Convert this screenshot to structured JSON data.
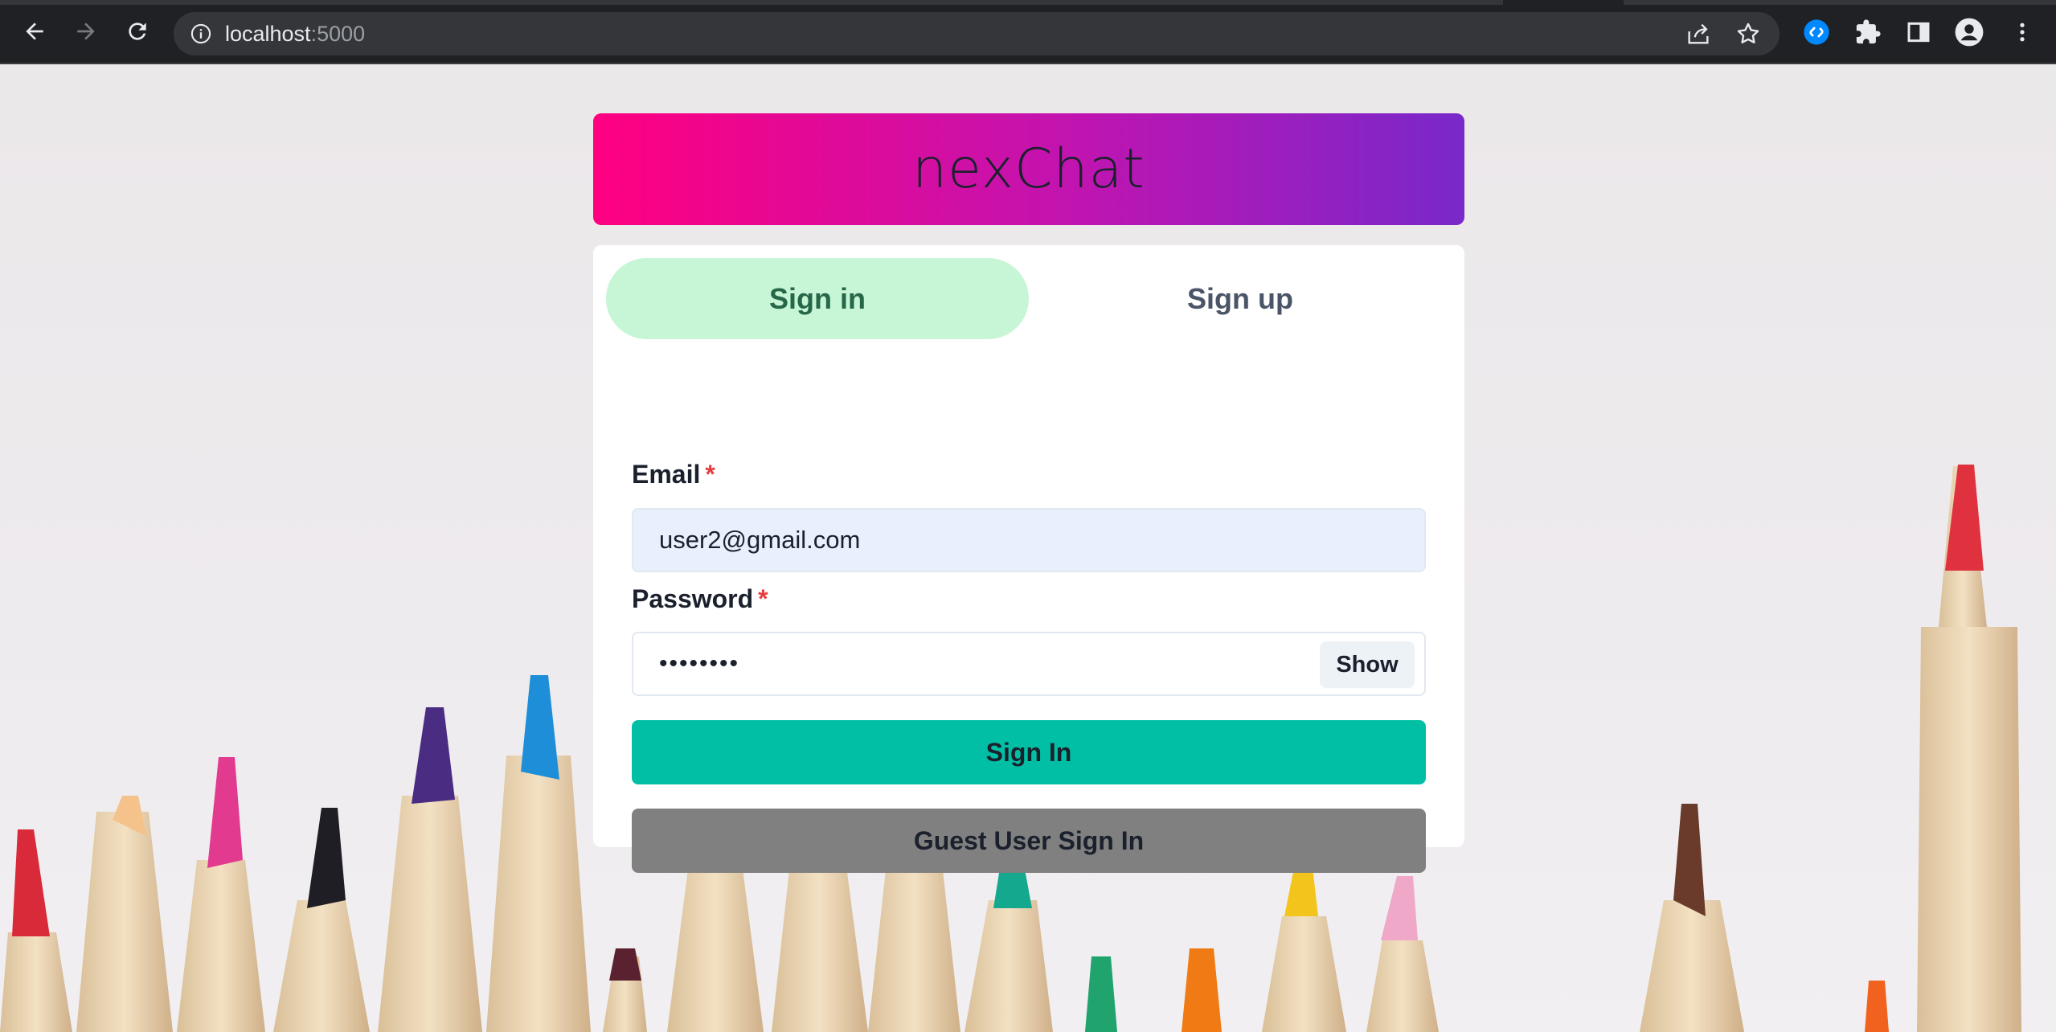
{
  "browser": {
    "url_host": "localhost",
    "url_port": ":5000"
  },
  "header": {
    "brand": "nexChat"
  },
  "tabs": [
    {
      "label": "Sign in",
      "active": true
    },
    {
      "label": "Sign up",
      "active": false
    }
  ],
  "form": {
    "email_label": "Email",
    "email_required": "*",
    "email_value": "user2@gmail.com",
    "password_label": "Password",
    "password_required": "*",
    "password_value": "••••••••",
    "show_label": "Show",
    "sign_in_label": "Sign In",
    "guest_label": "Guest User Sign In"
  },
  "colors": {
    "header_gradient_start": "#ff0080",
    "header_gradient_end": "#7928ca",
    "active_tab_bg": "#c6f6d5",
    "sign_in_button": "#00bfa5",
    "guest_button": "#808080",
    "required_marker": "#e53e3e",
    "autofill_bg": "#e8f0fe"
  },
  "icons": [
    "back-arrow-icon",
    "forward-arrow-icon",
    "reload-icon",
    "info-icon",
    "share-icon",
    "star-icon",
    "shazam-extension-icon",
    "puzzle-extensions-icon",
    "side-panel-icon",
    "profile-icon",
    "kebab-menu-icon"
  ]
}
